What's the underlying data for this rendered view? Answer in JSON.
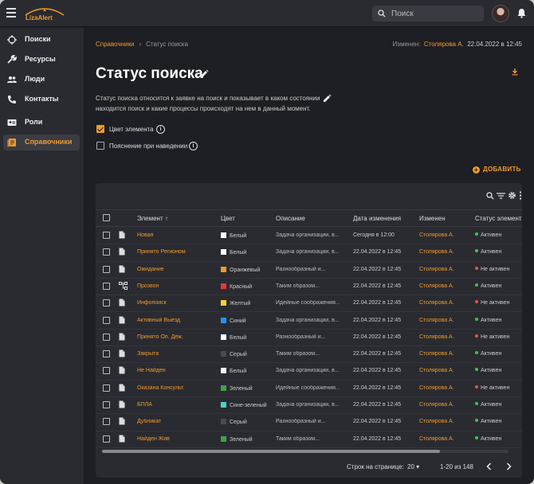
{
  "app": {
    "logo_text": "LizaAlert"
  },
  "search": {
    "placeholder": "Поиск"
  },
  "sidebar": {
    "items": [
      {
        "label": "Поиски",
        "icon": "crosshair-icon"
      },
      {
        "label": "Ресурсы",
        "icon": "wrench-icon"
      },
      {
        "label": "Люди",
        "icon": "people-icon"
      },
      {
        "label": "Контакты",
        "icon": "phone-icon"
      },
      {
        "label": "Роли",
        "icon": "id-card-icon"
      },
      {
        "label": "Справочники",
        "icon": "book-icon",
        "active": true
      }
    ]
  },
  "breadcrumb": {
    "parent": "Справочники",
    "current": "Статус поиска"
  },
  "meta": {
    "changed_label": "Изменен:",
    "changed_by": "Столярова А.",
    "changed_at": "22.04.2022 в 12:45"
  },
  "page": {
    "title": "Статус поиска",
    "description": "Статус поиска относится к заявке на поиск и показывает в каком состоянии находится поиск и какие процессы происходят на нем в данный момент."
  },
  "options": {
    "color_label": "Цвет элемента",
    "tooltip_label": "Пояснение при наведении",
    "color_checked": true,
    "tooltip_checked": false
  },
  "actions": {
    "add_label": "ДОБАВИТЬ"
  },
  "table": {
    "columns": [
      "Элемент",
      "Цвет",
      "Описание",
      "Дата изменения",
      "Изменен",
      "Статус элемента"
    ],
    "rows": [
      {
        "name": "Новая",
        "color": "Белый",
        "hex": "#ffffff",
        "desc": "Задача организации, в...",
        "date": "Сегодня в 12:00",
        "who": "Столярова А.",
        "status": "Активен",
        "active": true,
        "icon": "document"
      },
      {
        "name": "Принято Регионом",
        "color": "Белый",
        "hex": "#ffffff",
        "desc": "Задача организации, в...",
        "date": "22.04.2022 в 12:45",
        "who": "Столярова А.",
        "status": "Активен",
        "active": true,
        "icon": "document"
      },
      {
        "name": "Ожидание",
        "color": "Оранжевый",
        "hex": "#f09a2a",
        "desc": "Разнообразный и...",
        "date": "22.04.2022 в 12:45",
        "who": "Столярова А.",
        "status": "Не активен",
        "active": false,
        "icon": "document"
      },
      {
        "name": "Прозвон",
        "color": "Красный",
        "hex": "#e53935",
        "desc": "Таким образом...",
        "date": "22.04.2022 в 12:45",
        "who": "Столярова А.",
        "status": "Активен",
        "active": true,
        "icon": "tree"
      },
      {
        "name": "Инфопоиск",
        "color": "Желтый",
        "hex": "#f2d335",
        "desc": "Идейные соображения...",
        "date": "22.04.2022 в 12:45",
        "who": "Столярова А.",
        "status": "Не активен",
        "active": false,
        "icon": "document"
      },
      {
        "name": "Активный Выезд",
        "color": "Синий",
        "hex": "#2196f3",
        "desc": "Задача организации, в...",
        "date": "22.04.2022 в 12:45",
        "who": "Столярова А.",
        "status": "Активен",
        "active": true,
        "icon": "document"
      },
      {
        "name": "Принято Оп. Деж.",
        "color": "Белый",
        "hex": "#ffffff",
        "desc": "Разнообразный и...",
        "date": "22.04.2022 в 12:45",
        "who": "Столярова А.",
        "status": "Не активен",
        "active": false,
        "icon": "document"
      },
      {
        "name": "Закрыта",
        "color": "Серый",
        "hex": "#4a4b52",
        "desc": "Таким образом...",
        "date": "22.04.2022 в 12:45",
        "who": "Столярова А.",
        "status": "Активен",
        "active": true,
        "icon": "document"
      },
      {
        "name": "Не Найден",
        "color": "Белый",
        "hex": "#ffffff",
        "desc": "Задача организации, в...",
        "date": "22.04.2022 в 12:45",
        "who": "Столярова А.",
        "status": "Активен",
        "active": true,
        "icon": "document"
      },
      {
        "name": "Оказана Консульт.",
        "color": "Зеленый",
        "hex": "#43a047",
        "desc": "Идейные соображения...",
        "date": "22.04.2022 в 12:45",
        "who": "Столярова А.",
        "status": "Не активен",
        "active": false,
        "icon": "document"
      },
      {
        "name": "БПЛА",
        "color": "Сине-зеленый",
        "hex": "#4dd0c8",
        "desc": "Задача организации, в...",
        "date": "22.04.2022 в 12:45",
        "who": "Столярова А.",
        "status": "Активен",
        "active": true,
        "icon": "document"
      },
      {
        "name": "Дубликат",
        "color": "Серый",
        "hex": "#4a4b52",
        "desc": "Разнообразный и...",
        "date": "22.04.2022 в 12:45",
        "who": "Столярова А.",
        "status": "Активен",
        "active": true,
        "icon": "document"
      },
      {
        "name": "Найден Жив",
        "color": "Зеленый",
        "hex": "#43a047",
        "desc": "Таким образом...",
        "date": "22.04.2022 в 12:45",
        "who": "Столярова А.",
        "status": "Активен",
        "active": true,
        "icon": "document"
      }
    ]
  },
  "pagination": {
    "rows_label": "Строк на странице:",
    "rows_value": "20",
    "range": "1-20 из 148"
  },
  "colors": {
    "accent": "#f09a2a",
    "active": "#43c059",
    "inactive": "#e5534b"
  }
}
